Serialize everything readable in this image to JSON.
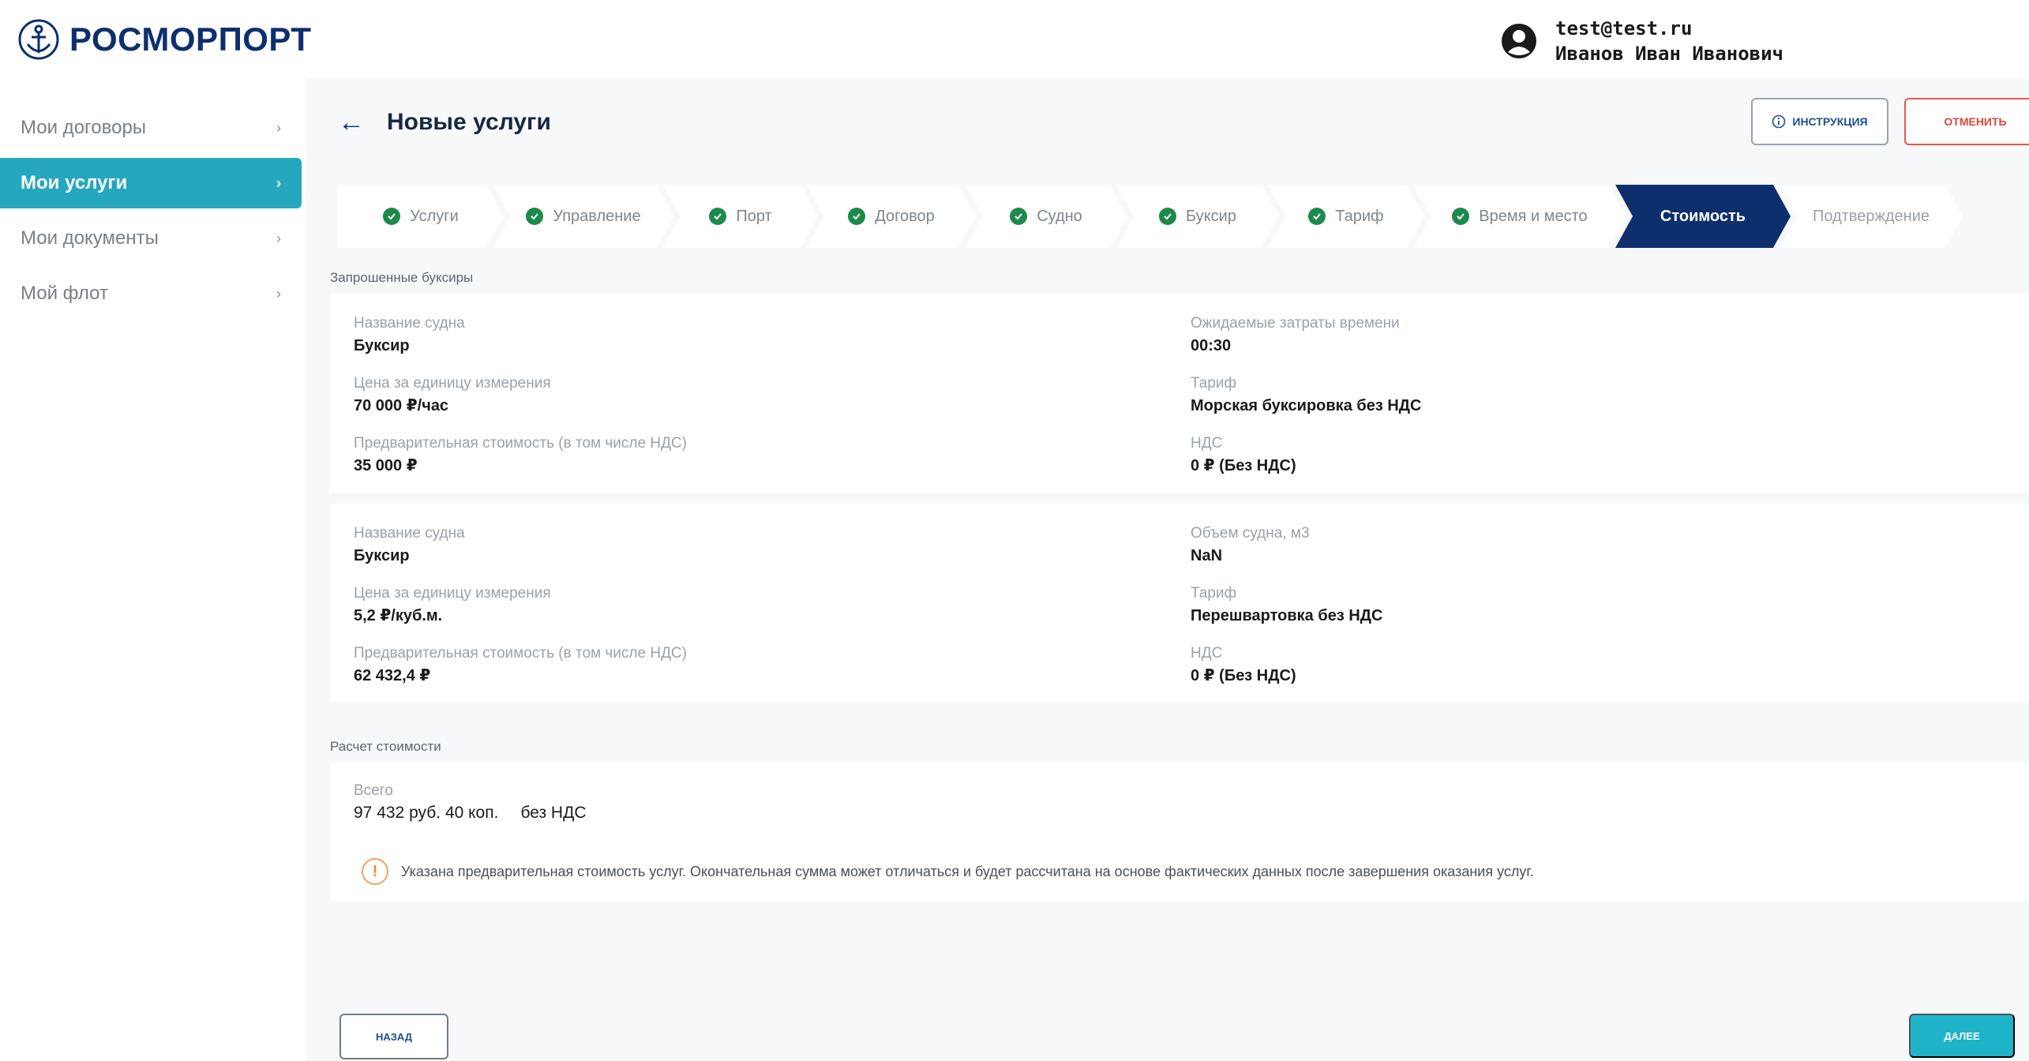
{
  "header": {
    "logo_text": "РОСМОРПОРТ",
    "user_email": "test@test.ru",
    "user_name": "Иванов Иван Иванович"
  },
  "sidebar": {
    "items": [
      {
        "label": "Мои договоры",
        "active": false
      },
      {
        "label": "Мои услуги",
        "active": true
      },
      {
        "label": "Мои документы",
        "active": false
      },
      {
        "label": "Мой флот",
        "active": false
      }
    ]
  },
  "page": {
    "title": "Новые услуги",
    "instructions_label": "инструкция",
    "cancel_label": "отменить"
  },
  "stepper": {
    "steps": [
      {
        "label": "Услуги",
        "state": "done"
      },
      {
        "label": "Управление",
        "state": "done"
      },
      {
        "label": "Порт",
        "state": "done"
      },
      {
        "label": "Договор",
        "state": "done"
      },
      {
        "label": "Судно",
        "state": "done"
      },
      {
        "label": "Буксир",
        "state": "done"
      },
      {
        "label": "Тариф",
        "state": "done"
      },
      {
        "label": "Время и место",
        "state": "done"
      },
      {
        "label": "Стоимость",
        "state": "current"
      },
      {
        "label": "Подтверждение",
        "state": "upcoming"
      }
    ]
  },
  "requested_tugs": {
    "section_label": "Запрошенные буксиры",
    "cards": [
      {
        "left": [
          {
            "label": "Название судна",
            "value": "Буксир"
          },
          {
            "label": "Цена за единицу измерения",
            "value": "70 000 ₽/час"
          },
          {
            "label": "Предварительная стоимость (в том числе НДС)",
            "value": "35 000 ₽"
          }
        ],
        "right": [
          {
            "label": "Ожидаемые затраты времени",
            "value": "00:30"
          },
          {
            "label": "Тариф",
            "value": "Морская буксировка без НДС"
          },
          {
            "label": "НДС",
            "value": "0 ₽ (Без НДС)"
          }
        ]
      },
      {
        "left": [
          {
            "label": "Название судна",
            "value": "Буксир"
          },
          {
            "label": "Цена за единицу измерения",
            "value": "5,2 ₽/куб.м."
          },
          {
            "label": "Предварительная стоимость (в том числе НДС)",
            "value": "62 432,4 ₽"
          }
        ],
        "right": [
          {
            "label": "Объем судна, м3",
            "value": "NaN"
          },
          {
            "label": "Тариф",
            "value": "Перешвартовка без НДС"
          },
          {
            "label": "НДС",
            "value": "0 ₽ (Без НДС)"
          }
        ]
      }
    ]
  },
  "cost_calc": {
    "section_label": "Расчет стоимости",
    "total_label": "Всего",
    "total_value": "97 432 руб. 40 коп.",
    "total_tax": "без НДС",
    "notice_icon": "!",
    "notice": "Указана предварительная стоимость услуг. Окончательная сумма может отличаться и будет рассчитана на основе фактических данных после завершения оказания услуг."
  },
  "footer": {
    "back_label": "назад",
    "next_label": "далее"
  },
  "colors": {
    "brand_navy": "#0e2f6e",
    "accent_teal": "#25a8bd",
    "done_green": "#1d8a4c",
    "cancel_red": "#e5574d",
    "warning_orange": "#f08b2e"
  }
}
